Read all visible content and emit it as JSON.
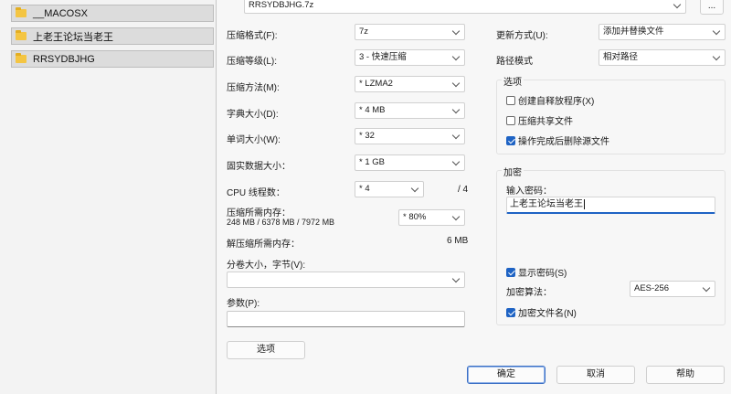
{
  "explorer": {
    "folders": [
      "__MACOSX",
      "上老王论坛当老王",
      "RRSYDBJHG"
    ]
  },
  "archive": {
    "name": "RRSYDBJHG.7z",
    "browse_label": "..."
  },
  "left": {
    "format": {
      "label": "压缩格式(F):",
      "value": "7z"
    },
    "level": {
      "label": "压缩等级(L):",
      "value": "3 - 快速压缩"
    },
    "method": {
      "label": "压缩方法(M):",
      "value": "* LZMA2"
    },
    "dict": {
      "label": "字典大小(D):",
      "value": "* 4 MB"
    },
    "word": {
      "label": "单词大小(W):",
      "value": "* 32"
    },
    "solid": {
      "label": "固实数据大小：",
      "value": "* 1 GB"
    },
    "cpu": {
      "label": "CPU 线程数：",
      "value": "* 4",
      "total": "/ 4"
    },
    "memory": {
      "label": "压缩所需内存：",
      "detail": "248 MB / 6378 MB / 7972 MB",
      "value": "* 80%"
    },
    "decompress": {
      "label": "解压缩所需内存：",
      "value": "6 MB"
    },
    "split": {
      "label": "分卷大小，字节(V):",
      "value": ""
    },
    "params": {
      "label": "参数(P):",
      "value": ""
    },
    "options_button": "选项"
  },
  "right": {
    "update": {
      "label": "更新方式(U):",
      "value": "添加并替换文件"
    },
    "path": {
      "label": "路径模式",
      "value": "相对路径"
    },
    "options": {
      "title": "选项",
      "sfx": {
        "label": "创建自释放程序(X)",
        "checked": false
      },
      "shared": {
        "label": "压缩共享文件",
        "checked": false
      },
      "delete": {
        "label": "操作完成后删除源文件",
        "checked": true
      }
    },
    "encryption": {
      "title": "加密",
      "password_label": "输入密码：",
      "password": "上老王论坛当老王",
      "show_password": {
        "label": "显示密码(S)",
        "checked": true
      },
      "algorithm": {
        "label": "加密算法：",
        "value": "AES-256"
      },
      "encrypt_names": {
        "label": "加密文件名(N)",
        "checked": true
      }
    }
  },
  "footer": {
    "ok": "确定",
    "cancel": "取消",
    "help": "帮助"
  },
  "colors": {
    "accent": "#1e63c4",
    "folder": "#f4c542"
  }
}
